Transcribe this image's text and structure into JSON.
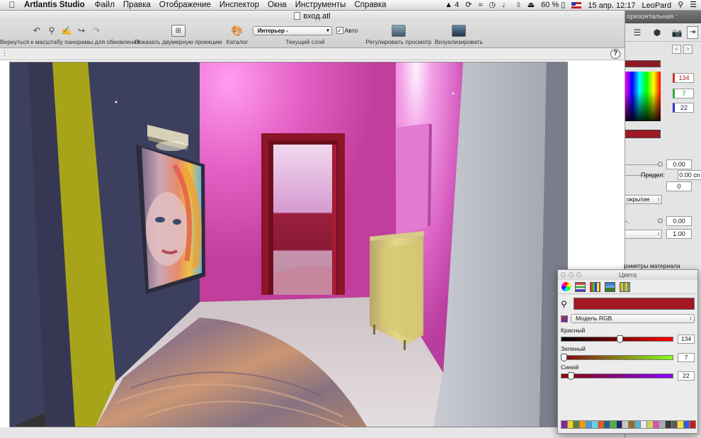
{
  "menubar": {
    "app_name": "Artlantis Studio",
    "menus": [
      "Файл",
      "Правка",
      "Отображение",
      "Инспектор",
      "Окна",
      "Инструменты",
      "Справка"
    ],
    "status": {
      "adobe_badge": "4",
      "battery": "60 %",
      "date_time": "15 апр. 12:17",
      "user": "LeoPard"
    }
  },
  "window": {
    "title": "вход.atl"
  },
  "toolbar": {
    "return_label": "Вернуться к масштабу панорамы для обновления",
    "show2d_label": "Показать двумерную проекцию",
    "catalog_label": "Каталог",
    "layer_select": "Интерьер -",
    "auto_label": "Авто",
    "current_layer_label": "Текущий слой",
    "adjust_label": "Регулировать просмотр",
    "render_label": "Визуализировать"
  },
  "subbar": {
    "help": "?"
  },
  "inspector": {
    "top_label": "оризонтальная :",
    "r_value": "134",
    "g_value": "7",
    "b_value": "22",
    "field1": "0.00",
    "limit_label": "Предел:",
    "limit_value": "0.00 cn",
    "field3": "0",
    "coating_popup": "окрытие",
    "row5_label": "-.",
    "field5": "0.00",
    "field6": "1.00",
    "footer_label": "раметры материала",
    "colors": {
      "bar": "#8d1a22",
      "swatch": "#9c1a23"
    }
  },
  "colors_panel": {
    "title": "Цвета",
    "current_color": "#a31823",
    "model": "Модель RGB",
    "red_label": "Красный",
    "red_value": "134",
    "green_label": "Зеленый",
    "green_value": "7",
    "blue_label": "Синий",
    "blue_value": "22",
    "swatches": [
      "#7a2aa0",
      "#f0d21c",
      "#6a7a3a",
      "#e89a1a",
      "#3aa0e0",
      "#6ad0e8",
      "#e05a1a",
      "#2a5a8a",
      "#4ab04a",
      "#1a2a6a",
      "#c8c8c8",
      "#9a6a2a",
      "#5ab0d0",
      "#e8e8e8",
      "#d0d060",
      "#e050b0",
      "#aaaaaa",
      "#3a3a3a",
      "#5a5a5a",
      "#f0e040",
      "#2a60e0",
      "#c02020"
    ]
  },
  "icons": {
    "apple": "apple-logo-icon",
    "undo": "undo-icon",
    "zoom": "zoom-icon",
    "pan": "pan-icon",
    "redo": "redo-icon"
  }
}
